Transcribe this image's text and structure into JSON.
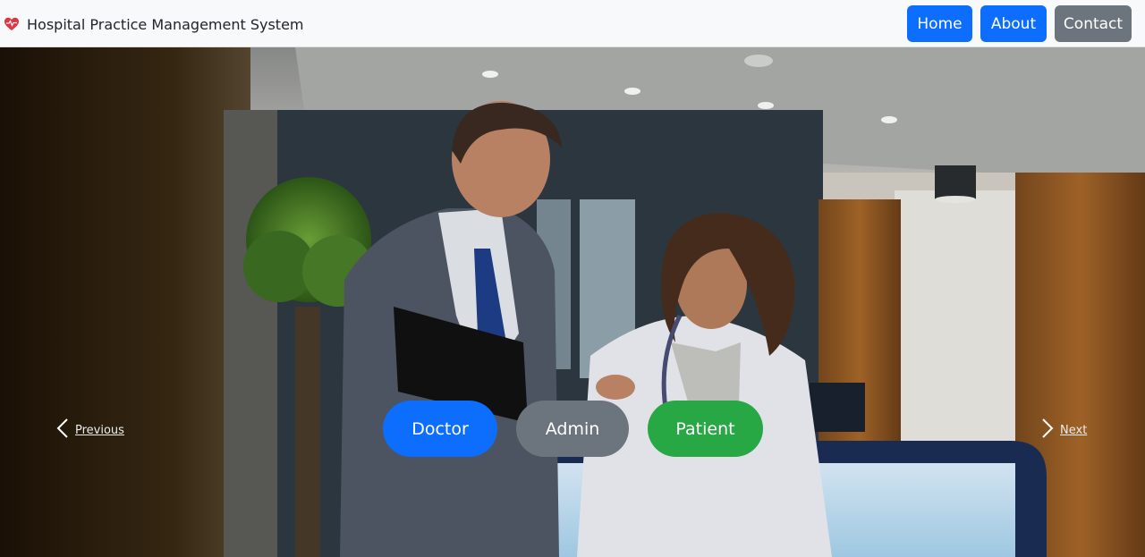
{
  "app": {
    "title": "Hospital Practice Management System",
    "logo_icon": "heart-pulse-icon"
  },
  "nav": {
    "home_label": "Home",
    "about_label": "About",
    "contact_label": "Contact"
  },
  "carousel": {
    "prev_label": "Previous",
    "next_label": "Next",
    "prev_icon": "chevron-left-icon",
    "next_icon": "chevron-right-icon"
  },
  "roles": {
    "doctor_label": "Doctor",
    "admin_label": "Admin",
    "patient_label": "Patient"
  },
  "colors": {
    "primary": "#0d6efd",
    "secondary": "#6c757d",
    "success": "#28a745",
    "navbar_bg": "#f8f9fa",
    "logo_red": "#dc3545"
  }
}
